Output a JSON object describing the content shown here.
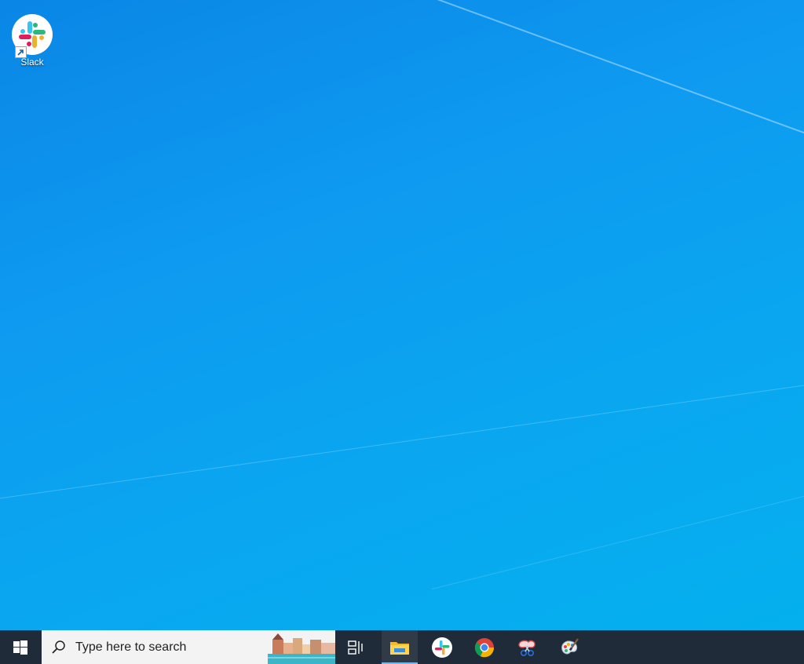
{
  "desktop": {
    "icons": [
      {
        "label": "Slack",
        "icon": "slack-icon",
        "shortcut": true
      }
    ]
  },
  "taskbar": {
    "start_icon": "windows-logo-icon",
    "search": {
      "placeholder": "Type here to search",
      "icon": "search-icon"
    },
    "buttons": [
      {
        "name": "Task View",
        "icon": "task-view-icon"
      },
      {
        "name": "File Explorer",
        "icon": "file-explorer-icon",
        "active": true
      },
      {
        "name": "Slack",
        "icon": "slack-icon"
      },
      {
        "name": "Google Chrome",
        "icon": "chrome-icon"
      },
      {
        "name": "Snipping Tool",
        "icon": "snipping-tool-icon"
      },
      {
        "name": "Paint",
        "icon": "paint-icon"
      }
    ]
  },
  "colors": {
    "wallpaper": "#0a9cf0",
    "taskbar": "#1f2b38",
    "search_box": "#f3f3f3",
    "active_indicator": "#76b9ed"
  }
}
